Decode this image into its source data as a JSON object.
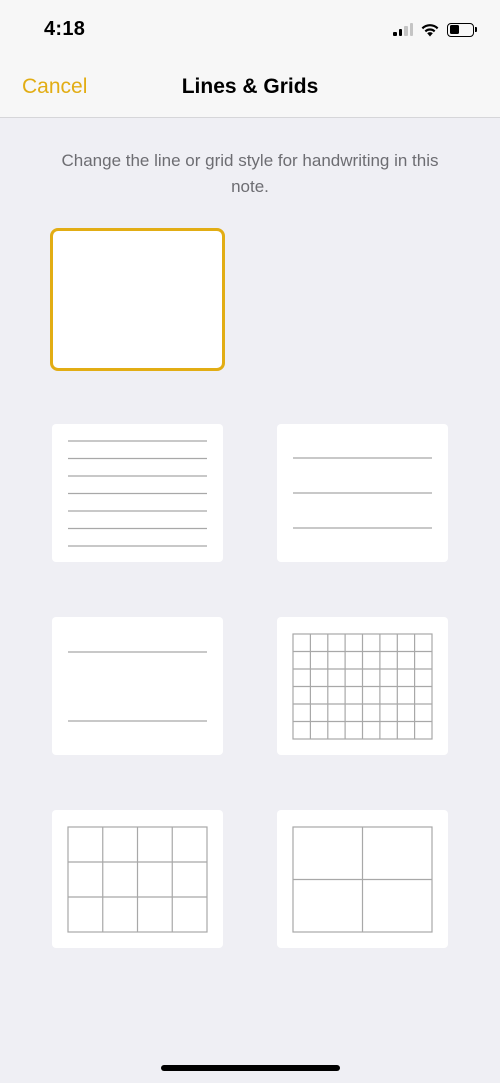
{
  "status_bar": {
    "time": "4:18",
    "icons": [
      "cellular-signal-icon",
      "wifi-icon",
      "battery-icon"
    ]
  },
  "nav": {
    "cancel_label": "Cancel",
    "title": "Lines & Grids"
  },
  "instructions": "Change the line or grid style for handwriting in this note.",
  "colors": {
    "accent": "#e2ad14",
    "background": "#efeff4",
    "line": "#a8a8a8"
  },
  "styles": [
    {
      "id": "none",
      "selected": true
    },
    {
      "id": "small-lines",
      "selected": false
    },
    {
      "id": "medium-lines",
      "selected": false
    },
    {
      "id": "large-lines",
      "selected": false
    },
    {
      "id": "small-grid",
      "selected": false
    },
    {
      "id": "medium-grid",
      "selected": false
    },
    {
      "id": "large-grid",
      "selected": false
    }
  ]
}
